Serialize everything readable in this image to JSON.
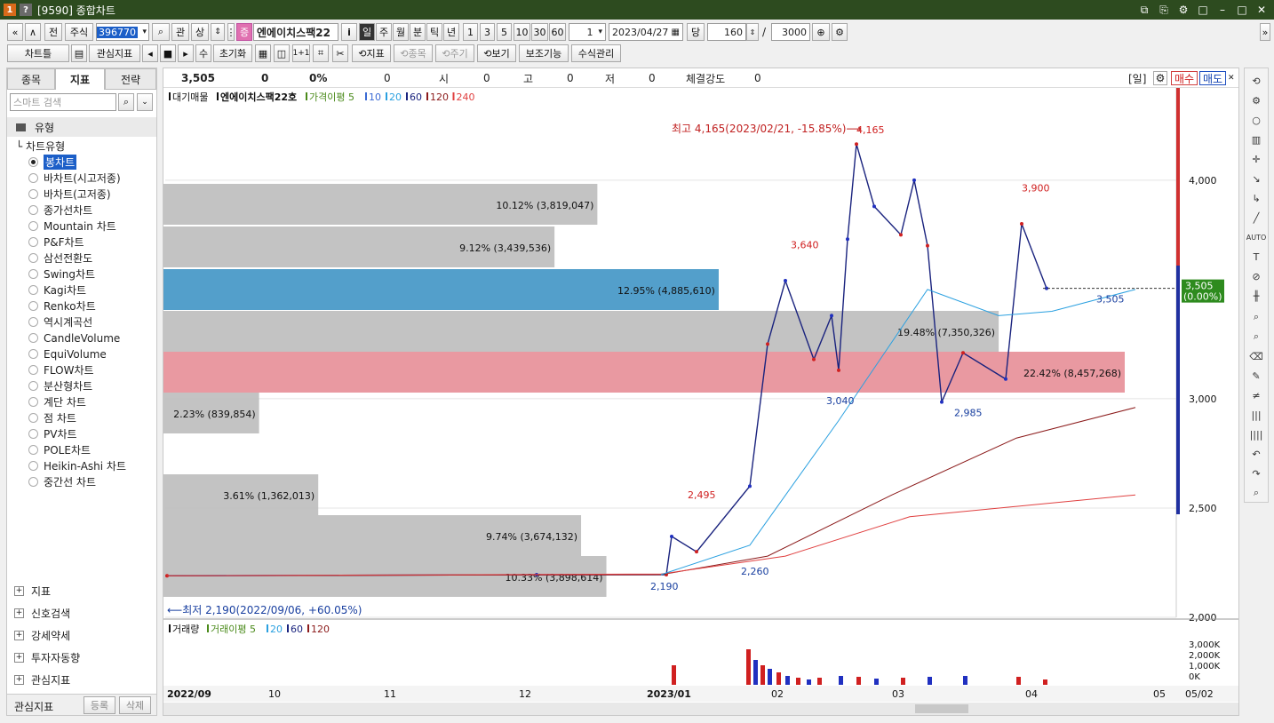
{
  "window": {
    "badge1": "1",
    "badge2": "?",
    "title": "[9590] 종합차트",
    "controls": [
      "⧉",
      "⎘",
      "⚙",
      "□",
      "–",
      "□",
      "✕"
    ]
  },
  "toolbar1": {
    "nav_first": "«",
    "nav_up": "∧",
    "prev": "전",
    "type_label": "주식",
    "code_value": "396770",
    "search_icon": "⌕",
    "btn_kwan": "관",
    "btn_sang": "상",
    "jung_badge": "증",
    "stock_name": "엔에이치스팩22",
    "info": "i",
    "periods": [
      "일",
      "주",
      "월",
      "분",
      "틱",
      "년"
    ],
    "intervals": [
      "1",
      "3",
      "5",
      "10",
      "30",
      "60"
    ],
    "interval_value": "1",
    "date_value": "2023/04/27",
    "dang_label": "당",
    "count_value": "160",
    "slash": "/",
    "total_value": "3000"
  },
  "toolbar2": {
    "chart_type": "차트틀",
    "watch_indicator": "관심지표",
    "play_controls": [
      "◂",
      "■",
      "▸"
    ],
    "su": "수",
    "reset": "초기화",
    "one_plus_one": "1+1",
    "indicator_btn": "⟲지표",
    "item_btn": "⟲종목",
    "period_btn": "⟲주기",
    "view_btn": "⟲보기",
    "aux_btn": "보조기능",
    "formula_btn": "수식관리"
  },
  "left_panel": {
    "tabs": [
      "종목",
      "지표",
      "전략"
    ],
    "search_placeholder": "스마트 검색",
    "section_type": "유형",
    "tree_root": "차트유형",
    "chart_types": [
      "봉차트",
      "바차트(시고저종)",
      "바차트(고저종)",
      "종가선차트",
      "Mountain 차트",
      "P&F차트",
      "삼선전환도",
      "Swing차트",
      "Kagi차트",
      "Renko차트",
      "역시계곡선",
      "CandleVolume",
      "EquiVolume",
      "FLOW차트",
      "분산형차트",
      "계단 차트",
      "점 차트",
      "PV차트",
      "POLE차트",
      "Heikin-Ashi 차트",
      "중간선 차트"
    ],
    "selected_index": 0,
    "sections": [
      "지표",
      "신호검색",
      "강세약세",
      "투자자동향",
      "관심지표"
    ],
    "footer_label": "관심지표",
    "footer_register": "등록",
    "footer_delete": "삭제"
  },
  "quote": {
    "price": "3,505",
    "change": "0",
    "rate": "0%",
    "volume": "0",
    "open_label": "시",
    "open": "0",
    "high_label": "고",
    "high": "0",
    "low_label": "저",
    "low": "0",
    "strength_label": "체결강도",
    "strength": "0",
    "period_tag": "[일]",
    "buy": "매수",
    "sell": "매도"
  },
  "legend_main": {
    "items": [
      {
        "text": "대기매물",
        "color": "#111111"
      },
      {
        "text": "엔에이치스팩22호",
        "color": "#111111"
      },
      {
        "text": "가격이평 5",
        "color": "#4a8a1a"
      },
      {
        "text": "10",
        "color": "#3a6ad4"
      },
      {
        "text": "20",
        "color": "#2aa0e0"
      },
      {
        "text": "60",
        "color": "#1a237e"
      },
      {
        "text": "120",
        "color": "#8b1a1a"
      },
      {
        "text": "240",
        "color": "#e04040"
      }
    ]
  },
  "legend_volume": {
    "items": [
      {
        "text": "거래량",
        "color": "#111111"
      },
      {
        "text": "거래이평 5",
        "color": "#4a8a1a"
      },
      {
        "text": "20",
        "color": "#2aa0e0"
      },
      {
        "text": "60",
        "color": "#1a237e"
      },
      {
        "text": "120",
        "color": "#8b1a1a"
      }
    ]
  },
  "annotations": {
    "high_note": "최고 4,165(2023/02/21, -15.85%)⟶",
    "low_note": "⟵최저 2,190(2022/09/06, +60.05%)",
    "point_labels": [
      "4,165",
      "3,640",
      "3,040",
      "2,985",
      "3,900",
      "3,505",
      "2,495",
      "2,260",
      "2,190"
    ]
  },
  "current_price_tag": {
    "price": "3,505",
    "rate": "(0.00%)"
  },
  "x_axis_labels": [
    "2022/09",
    "10",
    "11",
    "12",
    "2023/01",
    "02",
    "03",
    "04",
    "05",
    "05/02"
  ],
  "volume_axis_labels": [
    "3,000K",
    "2,000K",
    "1,000K",
    "0K"
  ],
  "chart_data": [
    {
      "type": "bar",
      "title": "대기매물",
      "price_axis": {
        "ylim": [
          2000,
          4300
        ],
        "ticks": [
          2000,
          2500,
          3000,
          4000
        ]
      },
      "bands": [
        {
          "label": "10.12% (3,819,047)",
          "percent": 10.12,
          "volume": 3819047,
          "color": "#c0c0c0"
        },
        {
          "label": "9.12% (3,439,536)",
          "percent": 9.12,
          "volume": 3439536,
          "color": "#c0c0c0"
        },
        {
          "label": "12.95% (4,885,610)",
          "percent": 12.95,
          "volume": 4885610,
          "color": "#4a9ac8"
        },
        {
          "label": "19.48% (7,350,326)",
          "percent": 19.48,
          "volume": 7350326,
          "color": "#c0c0c0"
        },
        {
          "label": "22.42% (8,457,268)",
          "percent": 22.42,
          "volume": 8457268,
          "color": "#e8949c"
        },
        {
          "label": "2.23% (839,854)",
          "percent": 2.23,
          "volume": 839854,
          "color": "#c0c0c0"
        },
        {
          "label": "",
          "percent": 0,
          "volume": 0,
          "color": "#c0c0c0"
        },
        {
          "label": "3.61% (1,362,013)",
          "percent": 3.61,
          "volume": 1362013,
          "color": "#c0c0c0"
        },
        {
          "label": "9.74% (3,674,132)",
          "percent": 9.74,
          "volume": 3674132,
          "color": "#c0c0c0"
        },
        {
          "label": "10.33% (3,898,614)",
          "percent": 10.33,
          "volume": 3898614,
          "color": "#c0c0c0"
        }
      ]
    },
    {
      "type": "line",
      "title": "엔에이치스팩22호",
      "y_range": [
        2000,
        4300
      ],
      "price_series": [
        {
          "x": "2022/09",
          "y": 2190
        },
        {
          "x": "2022/12",
          "y": 2195
        },
        {
          "x": "2023/01",
          "y": 2195
        },
        {
          "x": "2023/01",
          "y": 2370
        },
        {
          "x": "2023/01",
          "y": 2300
        },
        {
          "x": "2023/02",
          "y": 2600
        },
        {
          "x": "2023/02",
          "y": 3250
        },
        {
          "x": "2023/02",
          "y": 3540
        },
        {
          "x": "2023/02",
          "y": 3180
        },
        {
          "x": "2023/02",
          "y": 3380
        },
        {
          "x": "2023/02",
          "y": 3130
        },
        {
          "x": "2023/02",
          "y": 3730
        },
        {
          "x": "2023/02/21",
          "y": 4165
        },
        {
          "x": "2023/02",
          "y": 3880
        },
        {
          "x": "2023/03",
          "y": 3750
        },
        {
          "x": "2023/03",
          "y": 4000
        },
        {
          "x": "2023/03",
          "y": 3700
        },
        {
          "x": "2023/03",
          "y": 2985
        },
        {
          "x": "2023/03",
          "y": 3210
        },
        {
          "x": "2023/03",
          "y": 3090
        },
        {
          "x": "2023/04",
          "y": 3800
        },
        {
          "x": "2023/04",
          "y": 3505
        }
      ]
    }
  ]
}
